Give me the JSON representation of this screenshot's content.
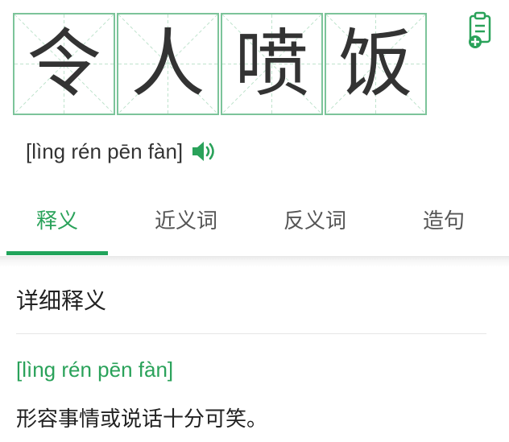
{
  "idiom": {
    "characters": [
      "令",
      "人",
      "喷",
      "饭"
    ],
    "pinyin": "[lìng rén pēn fàn]"
  },
  "tabs": [
    {
      "label": "释义",
      "active": true
    },
    {
      "label": "近义词",
      "active": false
    },
    {
      "label": "反义词",
      "active": false
    },
    {
      "label": "造句",
      "active": false
    }
  ],
  "details": {
    "section_title": "详细释义",
    "pinyin": "[lìng rén pēn fàn]",
    "definition": "形容事情或说话十分可笑。"
  },
  "icons": {
    "add_to_notes": "add-note-icon",
    "speaker": "speaker-icon"
  },
  "colors": {
    "accent": "#2aa25a",
    "grid_border": "#7cc49a",
    "grid_guides": "#bfe3cd"
  }
}
